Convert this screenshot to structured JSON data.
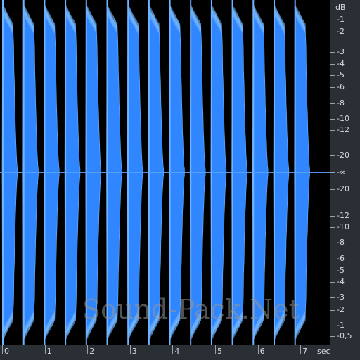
{
  "colors": {
    "background": "#000000",
    "waveform": "#2f86ff",
    "waveform_edge": "#6fb4ff",
    "ruler_bg": "#2a2f35",
    "ruler_text": "#d6dbe0"
  },
  "ruler_right": {
    "unit_label": "dB",
    "ticks": [
      "-1",
      "-2",
      "-3",
      "-4",
      "-5",
      "-6",
      "-8",
      "-10",
      "-12",
      "-20",
      "-∞",
      "-20",
      "-12",
      "-10",
      "-8",
      "-6",
      "-5",
      "-4",
      "-3",
      "-2",
      "-1",
      "-0,5"
    ]
  },
  "ruler_bottom": {
    "unit_label": "sec",
    "ticks": [
      "0",
      "1",
      "2",
      "3",
      "4",
      "5",
      "6",
      "7"
    ]
  },
  "watermark": "Sound-Pack.Net",
  "chart_data": {
    "type": "area",
    "title": "",
    "xlabel": "sec",
    "ylabel": "dB",
    "x_range": [
      0,
      7.5
    ],
    "y_scale": "dB (symmetric, -∞ at center)",
    "burst_count": 15,
    "burst_onsets_sec": [
      0.0,
      0.49,
      0.98,
      1.47,
      1.96,
      2.45,
      2.94,
      3.43,
      3.92,
      4.41,
      4.9,
      5.39,
      5.88,
      6.37,
      6.86
    ],
    "burst_duration_sec": 0.36,
    "peak_level_db": -1,
    "grid": false
  }
}
